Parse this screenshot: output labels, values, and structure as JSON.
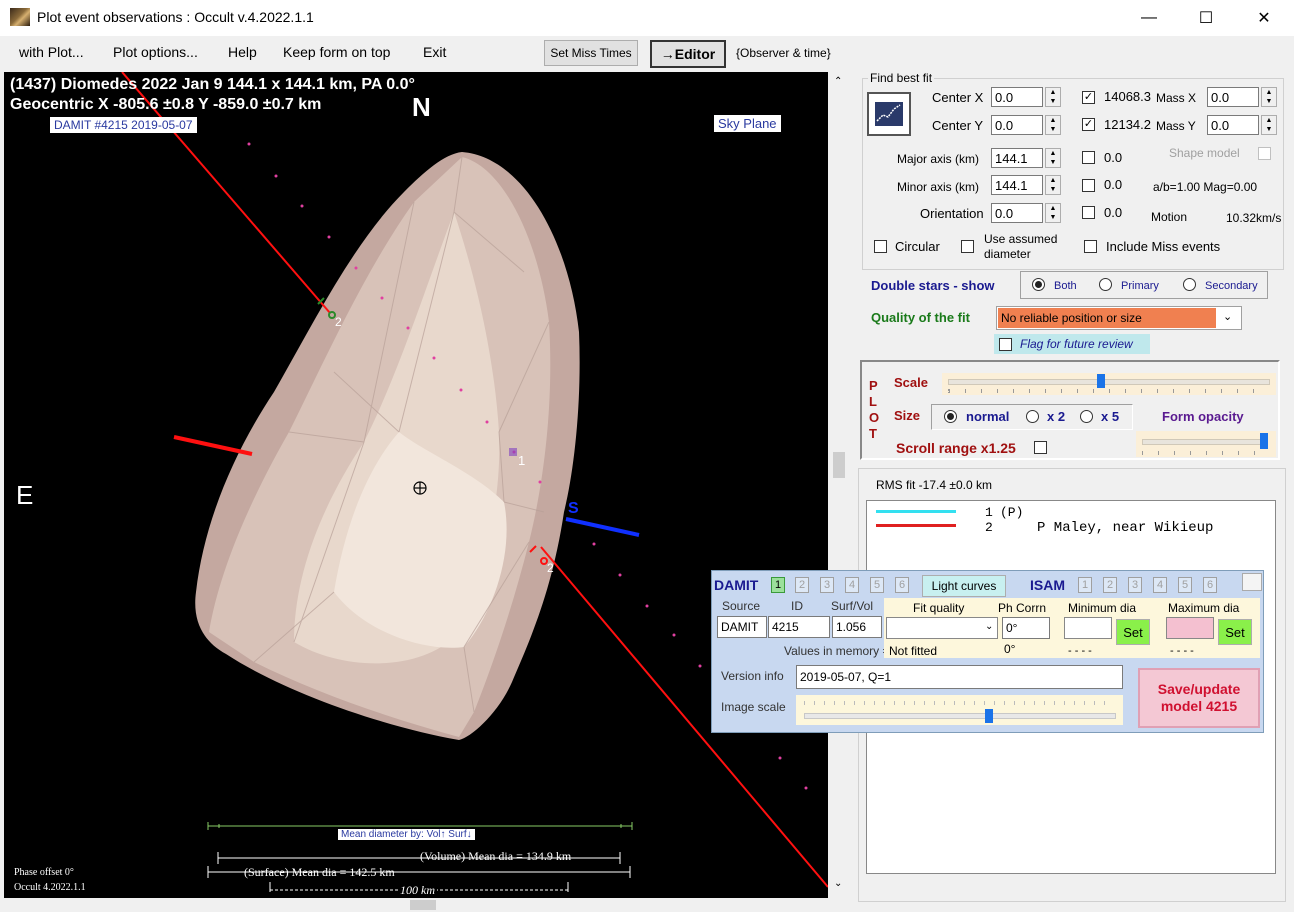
{
  "window": {
    "title": "Plot event observations : Occult v.4.2022.1.1",
    "min": "—",
    "max": "☐",
    "close": "✕"
  },
  "menu": {
    "items": [
      "with Plot...",
      "Plot options...",
      "Help",
      "Keep form on top",
      "Exit"
    ],
    "set_miss_times": "Set Miss Times",
    "editor": "→Editor",
    "observer_time": "{Observer & time}"
  },
  "plot": {
    "line1": "(1437) Diomedes  2022 Jan 9   144.1 x 144.1 km, PA 0.0°",
    "line2": "Geocentric X  -805.6 ±0.8  Y -859.0 ±0.7 km",
    "damit_label": "DAMIT #4215 2019-05-07",
    "sky_plane": "Sky Plane",
    "north": "N",
    "east": "E",
    "south": "S",
    "chord1": "1",
    "chord2a": "2",
    "chord2b": "2",
    "mean_dia_label": "Mean diameter by:  Vol↑  Surf↓",
    "vol_mean": "(Volume) Mean dia = 134.9 km",
    "surf_mean": "(Surface) Mean dia = 142.5 km",
    "scale_bar": "100 km",
    "phase_offset": "Phase offset 0°",
    "version": "Occult 4.2022.1.1"
  },
  "fit": {
    "find_best_fit": "Find best fit",
    "center_x_label": "Center X",
    "center_x": "0.0",
    "center_y_label": "Center Y",
    "center_y": "0.0",
    "major_label": "Major axis (km)",
    "major": "144.1",
    "minor_label": "Minor axis (km)",
    "minor": "144.1",
    "orient_label": "Orientation",
    "orient": "0.0",
    "mass_x_val": "14068.3",
    "mass_x_label": "Mass X",
    "mass_x": "0.0",
    "mass_y_val": "12134.2",
    "mass_y_label": "Mass Y",
    "mass_y": "0.0",
    "zero1": "0.0",
    "zero2": "0.0",
    "zero3": "0.0",
    "shape_model": "Shape model",
    "ab_mag": "a/b=1.00  Mag=0.00",
    "motion_label": "Motion",
    "motion": "10.32km/s",
    "circular": "Circular",
    "use_assumed": "Use assumed diameter",
    "include_miss": "Include Miss events"
  },
  "double_stars": {
    "label": "Double stars - show",
    "both": "Both",
    "primary": "Primary",
    "secondary": "Secondary"
  },
  "quality": {
    "label": "Quality of the fit",
    "value": "No reliable position or size",
    "flag": "Flag for future review"
  },
  "plotbox": {
    "letters": [
      "P",
      "L",
      "O",
      "T"
    ],
    "scale": "Scale",
    "size": "Size",
    "normal": "normal",
    "x2": "x 2",
    "x5": "x 5",
    "form_opacity": "Form opacity",
    "scroll_range": "Scroll range x1.25"
  },
  "rms": "RMS fit -17.4 ±0.0 km",
  "legend": {
    "row1_num": "1",
    "row1_text": "(P)",
    "row2_num": "2",
    "row2_text": "P Maley, near Wikieup",
    "row1_color": "#33e0f0",
    "row2_color": "#e02020"
  },
  "damit": {
    "title": "DAMIT",
    "tabs": [
      "1",
      "2",
      "3",
      "4",
      "5",
      "6"
    ],
    "light_curves": "Light curves",
    "isam": "ISAM",
    "isam_tabs": [
      "1",
      "2",
      "3",
      "4",
      "5",
      "6"
    ],
    "source_label": "Source",
    "id_label": "ID",
    "surfvol_label": "Surf/Vol",
    "source": "DAMIT",
    "id": "4215",
    "surfvol": "1.056",
    "values_in_memory": "Values in memory =>",
    "fit_quality_label": "Fit quality",
    "ph_corrn_label": "Ph Corrn",
    "ph_corrn": "0°",
    "not_fitted": "Not fitted",
    "ph_mem": "0°",
    "min_dia_label": "Minimum dia",
    "max_dia_label": "Maximum dia",
    "set": "Set",
    "dashes": "- - - -",
    "version_label": "Version info",
    "version": "2019-05-07, Q=1",
    "image_scale": "Image scale",
    "save": "Save/update model 4215"
  }
}
